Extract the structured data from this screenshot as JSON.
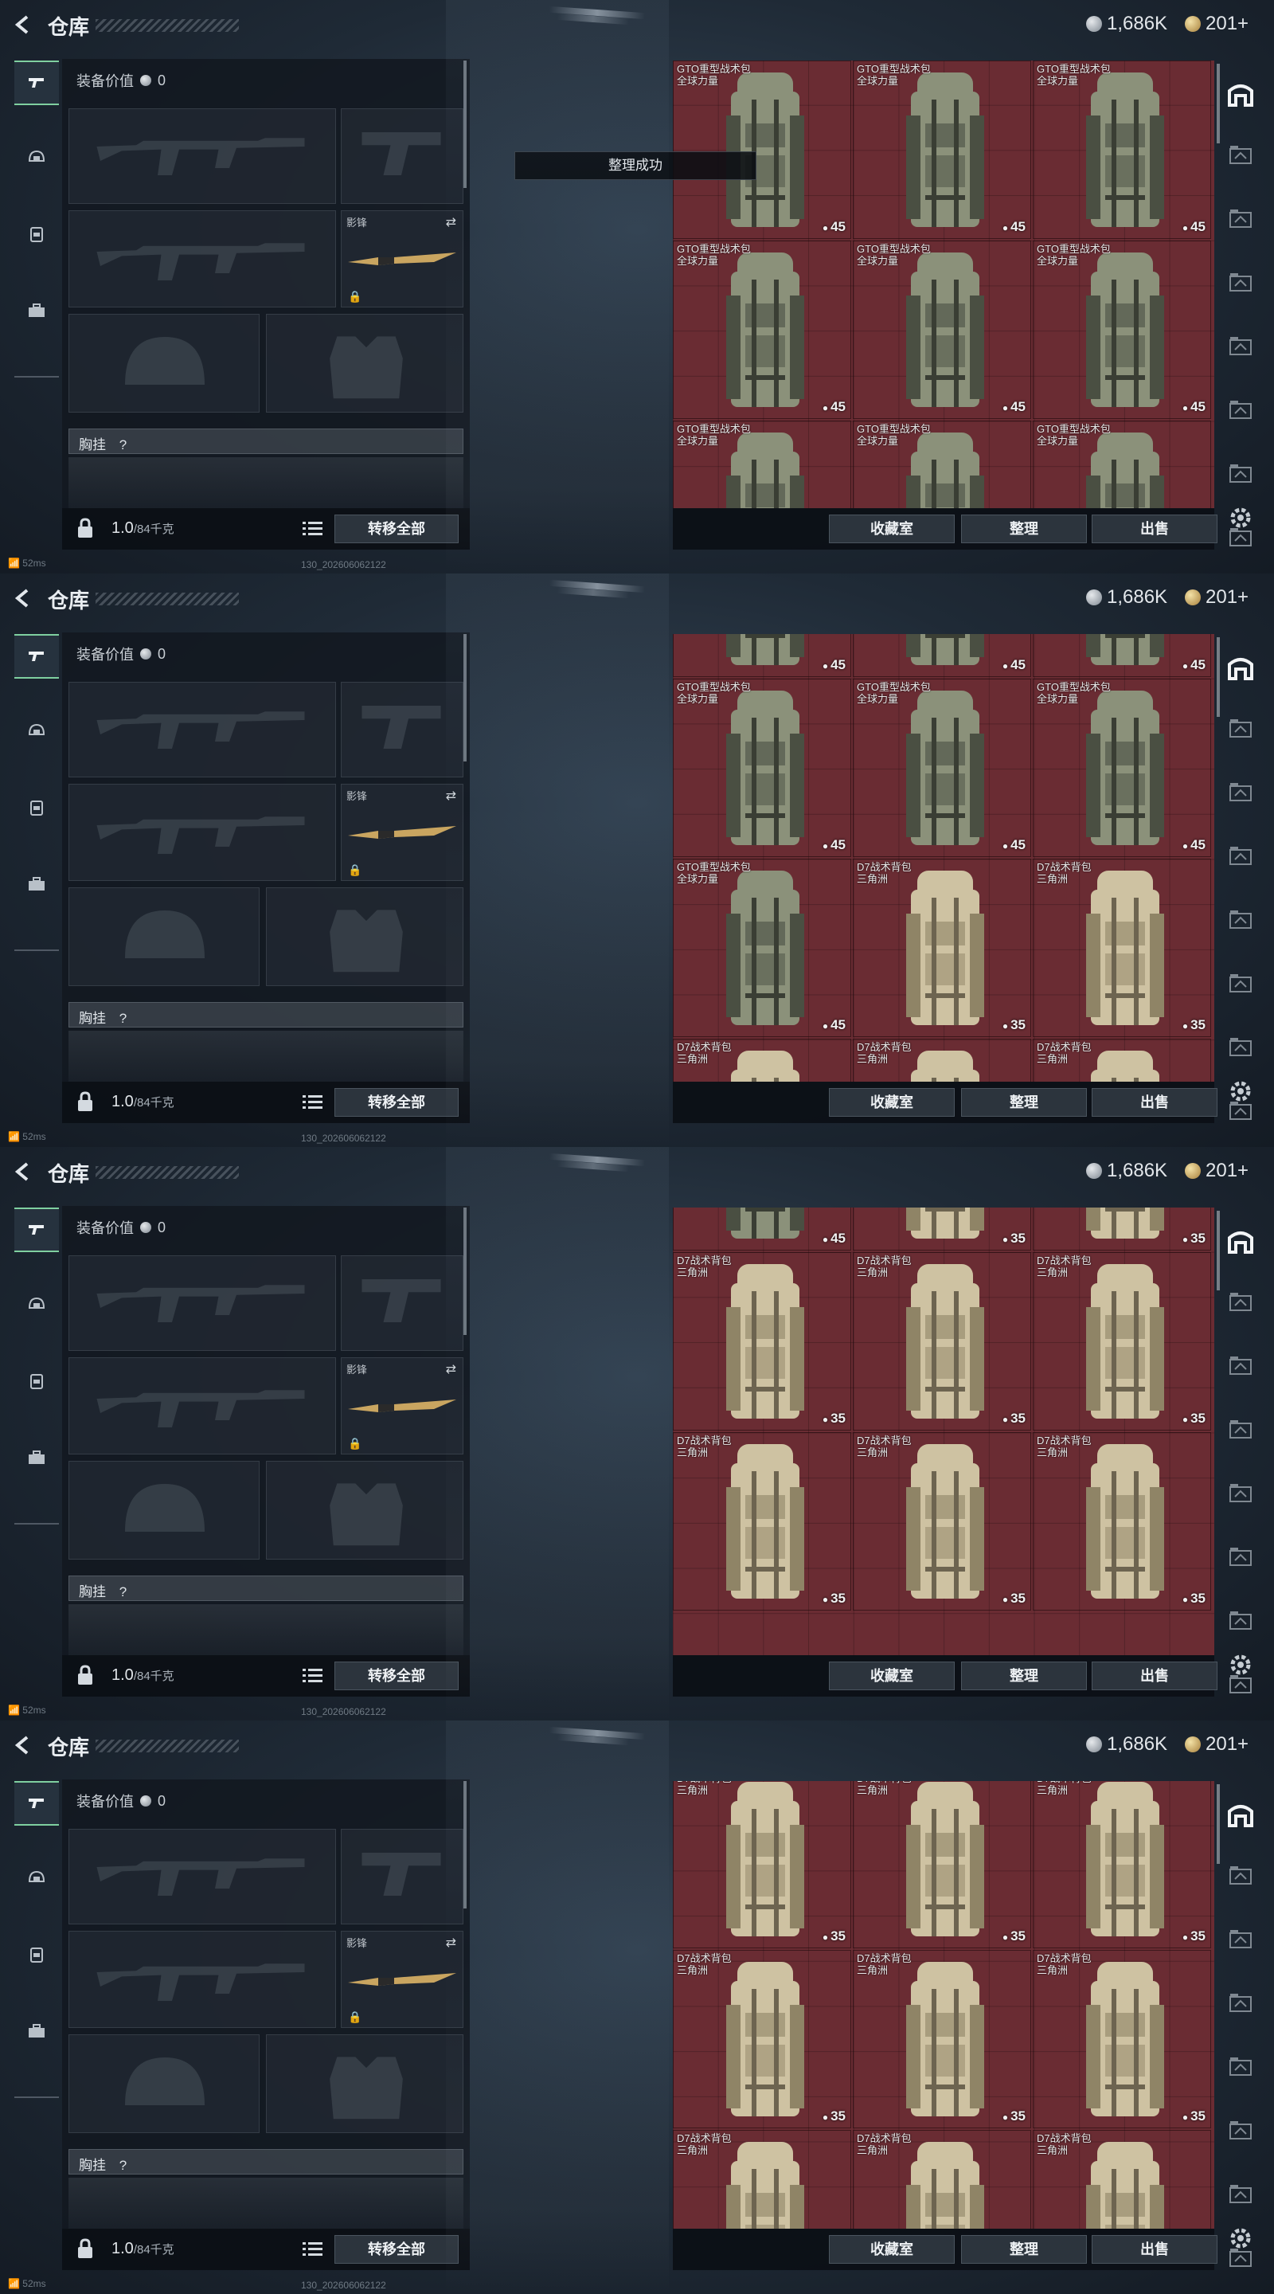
{
  "header": {
    "title": "仓库",
    "silver_amount": "1,686K",
    "gold_amount": "201+"
  },
  "toast": {
    "text": "整理成功"
  },
  "equipment": {
    "value_label": "装备价值",
    "value": "0",
    "melee_label": "影锋",
    "vest_label": "胸挂",
    "vest_help": "?",
    "weight": "1.0",
    "weight_max": "/84千克",
    "transfer_all": "转移全部"
  },
  "inventory_actions": {
    "collection_room": "收藏室",
    "sort": "整理",
    "sell": "出售"
  },
  "status": {
    "ping": "52ms",
    "build": "130_202606062122"
  },
  "items": {
    "gto": {
      "name_line1": "GTO重型战术包",
      "name_line2": "全球力量",
      "weight_value": "45"
    },
    "d7": {
      "name_line1": "D7战术背包",
      "name_line2": "三角洲",
      "weight_value": "35"
    }
  },
  "colors": {
    "accent": "#7fd0a0",
    "inventory_bg": "#6a2c33",
    "gto_bag": "#8c9278",
    "d7_bag": "#cfc3a3"
  },
  "icons": [
    "back-arrow-icon",
    "silver-coin-icon",
    "gold-coin-icon",
    "pistol-icon",
    "helmet-icon",
    "backpack-icon",
    "briefcase-icon",
    "lock-icon",
    "swap-icon",
    "list-icon",
    "home-icon",
    "gear-icon"
  ]
}
